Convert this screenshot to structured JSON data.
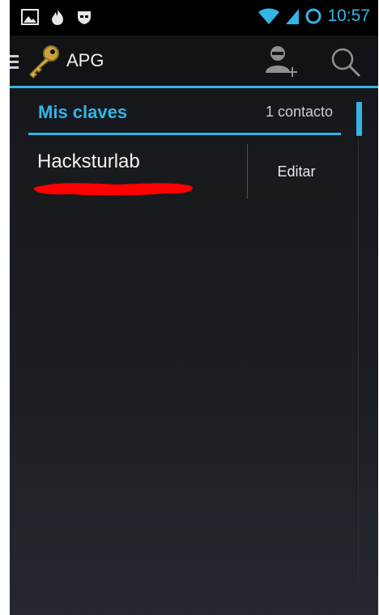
{
  "status_bar": {
    "icons_left": [
      "gallery-icon",
      "fire-icon",
      "incognito-icon"
    ],
    "icons_right": [
      "wifi-icon",
      "signal-icon",
      "sync-ring-icon"
    ],
    "time": "10:57",
    "accent": "#33b5e5"
  },
  "action_bar": {
    "title": "APG",
    "app_icon": "key-icon",
    "actions": [
      "add-contact-icon",
      "search-icon"
    ]
  },
  "list": {
    "section_title": "Mis claves",
    "section_count": "1 contacto",
    "items": [
      {
        "name": "Hacksturlab",
        "action": "Editar"
      }
    ]
  }
}
